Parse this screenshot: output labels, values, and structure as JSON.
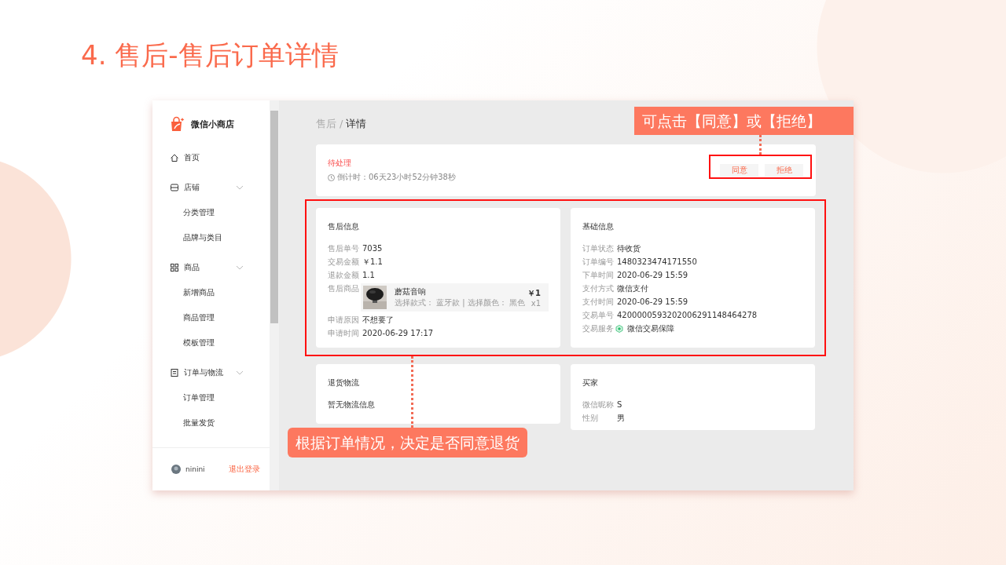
{
  "slide_title": "4. 售后-售后订单详情",
  "app": {
    "sidebar": {
      "brand": "微信小商店",
      "groups": [
        {
          "label": "首页"
        },
        {
          "label": "店铺",
          "expanded": true,
          "children": [
            "分类管理",
            "品牌与类目"
          ]
        },
        {
          "label": "商品",
          "expanded": true,
          "children": [
            "新增商品",
            "商品管理",
            "模板管理"
          ]
        },
        {
          "label": "订单与物流",
          "expanded": true,
          "children": [
            "订单管理",
            "批量发货"
          ]
        }
      ],
      "user": {
        "name": "ninini",
        "logout": "退出登录"
      }
    },
    "breadcrumb": [
      {
        "label": "售后",
        "current": false
      },
      {
        "separator": "/"
      },
      {
        "label": "详情",
        "current": true
      }
    ],
    "status_card": {
      "status": "待处理",
      "countdown": "倒计时：06天23小时52分钟38秒",
      "buttons": [
        "同意",
        "拒绝"
      ]
    },
    "after_sale": {
      "title": "售后信息",
      "rows": [
        {
          "label": "售后单号",
          "value": "7035"
        },
        {
          "label": "交易金额",
          "value": "￥1.1"
        },
        {
          "label": "退款金额",
          "value": "1.1"
        }
      ],
      "product": {
        "label": "售后商品",
        "name": "蘑菇音响",
        "spec": "选择款式： 蓝牙款 | 选择颜色： 黑色",
        "price": "￥1",
        "quantity": "x1"
      },
      "rows_after": [
        {
          "label": "申请原因",
          "value": "不想要了"
        },
        {
          "label": "申请时间",
          "value": "2020-06-29 17:17"
        }
      ]
    },
    "basic": {
      "title": "基础信息",
      "rows": [
        {
          "label": "订单状态",
          "value": "待收货"
        },
        {
          "label": "订单编号",
          "value": "1480323474171550"
        },
        {
          "label": "下单时间",
          "value": "2020-06-29 15:59"
        },
        {
          "label": "支付方式",
          "value": "微信支付"
        },
        {
          "label": "支付时间",
          "value": "2020-06-29 15:59"
        },
        {
          "label": "交易单号",
          "value": "4200000593202006291148464278"
        },
        {
          "label": "交易服务",
          "value": "微信交易保障",
          "kind": "badge"
        }
      ]
    },
    "logistics": {
      "title": "退货物流",
      "text": "暂无物流信息"
    },
    "buyer": {
      "title": "买家",
      "rows": [
        {
          "label": "微信昵称",
          "value": "S"
        },
        {
          "label": "性别",
          "value": "男"
        }
      ]
    }
  },
  "annotations": [
    {
      "text": "可点击【同意】或【拒绝】"
    },
    {
      "text": "根据订单情况，决定是否同意退货"
    }
  ]
}
